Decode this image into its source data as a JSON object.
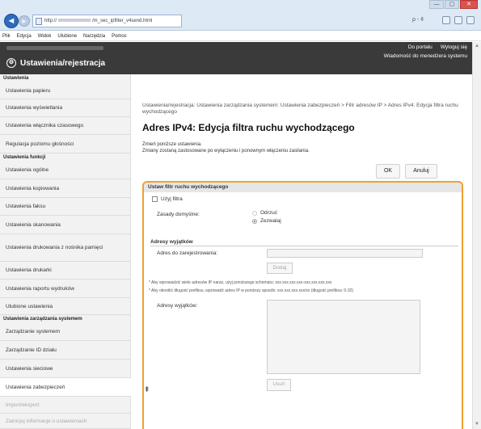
{
  "browser": {
    "address": "http://",
    "address_rest": "/m_sec_ipfilter_v4send.html",
    "search_label": "ρ - ¢",
    "window_min": "—",
    "window_max": "▢",
    "window_close": "✕",
    "menu": [
      "Plik",
      "Edycja",
      "Widok",
      "Ulubione",
      "Narzędzia",
      "Pomoc"
    ]
  },
  "header": {
    "title": "Ustawienia/rejestracja",
    "link_portal": "Do portalu",
    "link_logout": "Wyloguj się",
    "link_message": "Wiadomość do menedżera systemu"
  },
  "sidebar": {
    "section1": "Ustawienia",
    "items1": [
      "Ustawienia papieru",
      "Ustawienia wyświetlania",
      "Ustawienia włącznika czasowego",
      "Regulacja poziomu głośności"
    ],
    "section2": "Ustawienia funkcji",
    "items2": [
      "Ustawienia ogólne",
      "Ustawienia kopiowania",
      "Ustawienia faksu",
      "Ustawienia skanowania",
      "Ustawienia drukowania z nośnika pamięci",
      "Ustawienia drukarki",
      "Ustawienia raportu wydruków",
      "Ulubione ustawienia"
    ],
    "section3": "Ustawienia zarządzania systemem",
    "items3": [
      "Zarządzanie systemem",
      "Zarządzanie ID działu",
      "Ustawienia sieciowe",
      "Ustawienia zabezpieczeń",
      "Import/eksport",
      "Zainicjuj informacje o ustawieniach"
    ]
  },
  "main": {
    "breadcrumb": "Ustawienia/rejestracja: Ustawienia zarządzania systemem: Ustawienia zabezpieczeń > Filtr adresów IP > Adres IPv4: Edycja filtra ruchu wychodzącego",
    "title": "Adres IPv4: Edycja filtra ruchu wychodzącego",
    "note1": "Zmień poniższe ustawienia.",
    "note2": "Zmiany zostaną zastosowane po wyłączeniu i ponownym włączeniu zasilania.",
    "ok": "OK",
    "cancel": "Anuluj",
    "panel_title": "Ustaw filtr ruchu wychodzącego",
    "use_filter": "Użyj filtra",
    "default_policy": "Zasady domyślne:",
    "reject": "Odrzuć",
    "allow": "Zezwalaj",
    "exceptions_head": "Adresy wyjątków",
    "address_to_register": "Adres do zarejestrowania:",
    "add": "Dodaj",
    "hint1": "* Aby wprowadzić wiele adresów IP naraz, użyj poniższego schematu: xxx.xxx.xxx.xxx-xxx.xxx.xxx.xxx",
    "hint2": "* Aby określić długość prefiksu, wprowadź adres IP w poniższy sposób: xxx.xxx.xxx.xxx/xx (długość prefiksu: 0-32)",
    "exceptions_label": "Adresy wyjątków:",
    "remove": "Usuń",
    "to_top": "⇞"
  }
}
